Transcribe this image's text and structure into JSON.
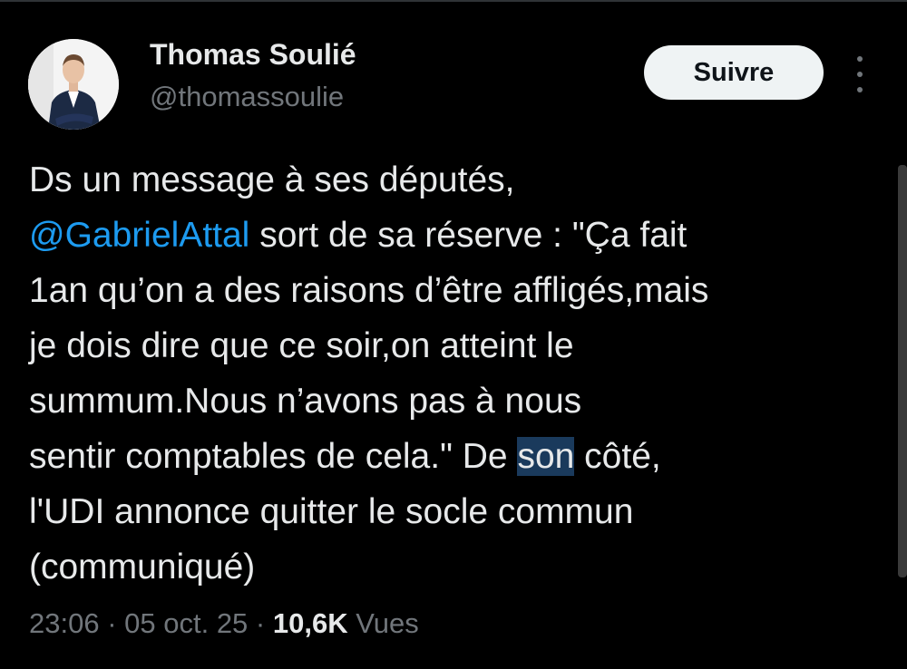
{
  "author": {
    "name": "Thomas Soulié",
    "handle": "@thomassoulie",
    "avatar_icon": "person-portrait"
  },
  "actions": {
    "follow_label": "Suivre",
    "more_icon": "vertical-ellipsis-icon"
  },
  "tweet": {
    "line1": "Ds un message à ses députés,",
    "mention": "@GabrielAttal",
    "line2_rest": " sort de sa réserve : \"Ça fait",
    "line3": "1an qu’on a des raisons d’être affligés,mais",
    "line4": "je dois dire que ce soir,on atteint le",
    "line5": "summum.Nous n’avons pas à nous",
    "line6_a": "sentir comptables de cela.\" De ",
    "line6_sel": "son",
    "line6_b": " côté,",
    "line7": "l'UDI annonce quitter le socle commun",
    "line8": "(communiqué)"
  },
  "meta": {
    "time": "23:06",
    "sep1": " · ",
    "date": "05 oct. 25",
    "sep2": " · ",
    "views_count": "10,6K",
    "views_label": " Vues"
  },
  "colors": {
    "background": "#000000",
    "text": "#e7e9ea",
    "muted": "#71767b",
    "link": "#1d9bf0",
    "selection": "#1a3a5c"
  }
}
